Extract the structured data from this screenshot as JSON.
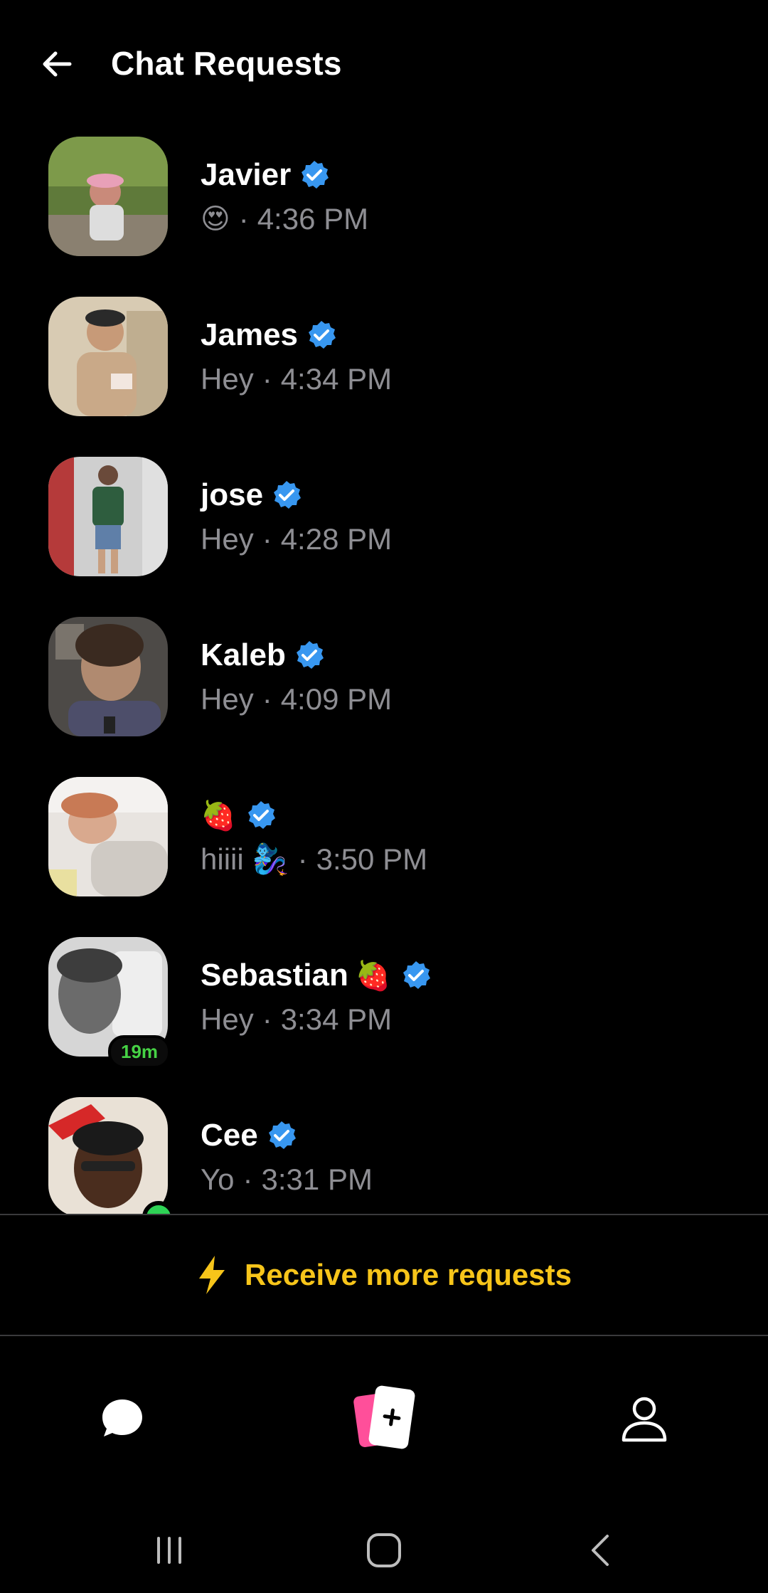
{
  "header": {
    "title": "Chat Requests"
  },
  "requests": [
    {
      "name": "Javier",
      "name_emoji": "",
      "message": "😍",
      "time": "4:36 PM"
    },
    {
      "name": "James",
      "name_emoji": "",
      "message": "Hey",
      "time": "4:34 PM"
    },
    {
      "name": "jose",
      "name_emoji": "",
      "message": "Hey",
      "time": "4:28 PM"
    },
    {
      "name": "Kaleb",
      "name_emoji": "",
      "message": "Hey",
      "time": "4:09 PM"
    },
    {
      "name": "",
      "name_emoji": "🍓",
      "message": "hiiii 🧞‍♀️",
      "time": "3:50 PM"
    },
    {
      "name": "Sebastian",
      "name_emoji": "🍓",
      "message": "Hey",
      "time": "3:34 PM",
      "badge": "19m"
    },
    {
      "name": "Cee",
      "name_emoji": "",
      "message": "Yo",
      "time": "3:31 PM",
      "online": true
    }
  ],
  "receive_more": {
    "label": "Receive more requests"
  },
  "tabs": {
    "chat": "chat-icon",
    "cards": "add-card-icon",
    "profile": "profile-icon"
  },
  "colors": {
    "accent": "#f7c51a",
    "verified": "#3897f0",
    "online": "#2ed255",
    "badge_text": "#46d245",
    "pink": "#ff4f9a"
  }
}
